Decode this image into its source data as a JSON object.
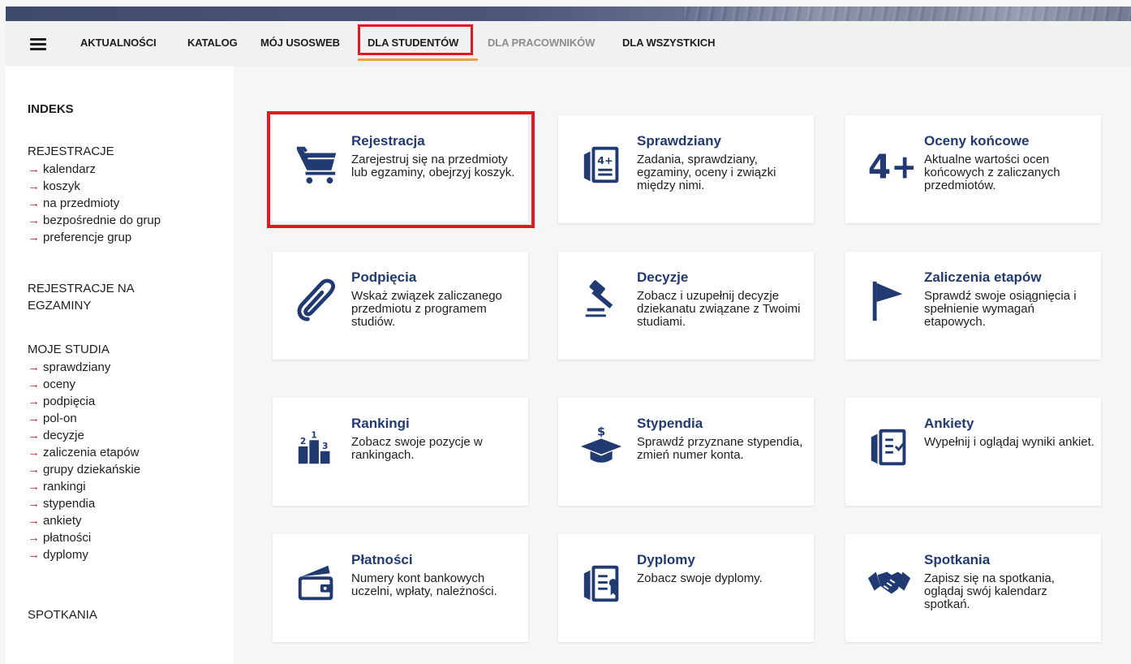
{
  "nav": {
    "items": [
      {
        "label": "AKTUALNOŚCI"
      },
      {
        "label": "KATALOG"
      },
      {
        "label": "MÓJ USOSWEB"
      },
      {
        "label": "DLA STUDENTÓW"
      },
      {
        "label": "DLA PRACOWNIKÓW"
      },
      {
        "label": "DLA WSZYSTKICH"
      }
    ]
  },
  "sidebar": {
    "indeks": "INDEKS",
    "rejestracje": "REJESTRACJE",
    "rejestracje_links": [
      "kalendarz",
      "koszyk",
      "na przedmioty",
      "bezpośrednie do grup",
      "preferencje grup"
    ],
    "rejestracje_egz_1": "REJESTRACJE NA",
    "rejestracje_egz_2": "EGZAMINY",
    "moje_studia": "MOJE STUDIA",
    "moje_studia_links": [
      "sprawdziany",
      "oceny",
      "podpięcia",
      "pol-on",
      "decyzje",
      "zaliczenia etapów",
      "grupy dziekańskie",
      "rankingi",
      "stypendia",
      "ankiety",
      "płatności",
      "dyplomy"
    ],
    "spotkania": "SPOTKANIA",
    "arrow": "→"
  },
  "cards": [
    {
      "title": "Rejestracja",
      "desc": "Zarejestruj się na przedmioty lub egzaminy, obejrzyj koszyk.",
      "icon": "cart-icon"
    },
    {
      "title": "Sprawdziany",
      "desc": "Zadania, sprawdziany, egzaminy, oceny i związki między nimi.",
      "icon": "test-sheet-icon"
    },
    {
      "title": "Oceny końcowe",
      "desc": "Aktualne wartości ocen końcowych z zaliczanych przedmiotów.",
      "icon": "grade-icon",
      "icon_text": "4+"
    },
    {
      "title": "Podpięcia",
      "desc": "Wskaż związek zaliczanego przedmiotu z programem studiów.",
      "icon": "paperclip-icon"
    },
    {
      "title": "Decyzje",
      "desc": "Zobacz i uzupełnij decyzje dziekanatu związane z Twoimi studiami.",
      "icon": "gavel-icon"
    },
    {
      "title": "Zaliczenia etapów",
      "desc": "Sprawdź swoje osiągnięcia i spełnienie wymagań etapowych.",
      "icon": "flag-icon"
    },
    {
      "title": "Rankingi",
      "desc": "Zobacz swoje pozycje w rankingach.",
      "icon": "podium-icon"
    },
    {
      "title": "Stypendia",
      "desc": "Sprawdź przyznane stypendia, zmień numer konta.",
      "icon": "scholarship-cap-icon"
    },
    {
      "title": "Ankiety",
      "desc": "Wypełnij i oglądaj wyniki ankiet.",
      "icon": "survey-icon"
    },
    {
      "title": "Płatności",
      "desc": "Numery kont bankowych uczelni, wpłaty, należności.",
      "icon": "wallet-icon"
    },
    {
      "title": "Dyplomy",
      "desc": "Zobacz swoje dyplomy.",
      "icon": "diploma-icon"
    },
    {
      "title": "Spotkania",
      "desc": "Zapisz się na spotkania, oglądaj swój kalendarz spotkań.",
      "icon": "handshake-icon"
    }
  ],
  "colors": {
    "accent": "#213a72",
    "highlight": "#e01a22",
    "active_underline": "#f2a23a",
    "arrow": "#d2212e"
  }
}
